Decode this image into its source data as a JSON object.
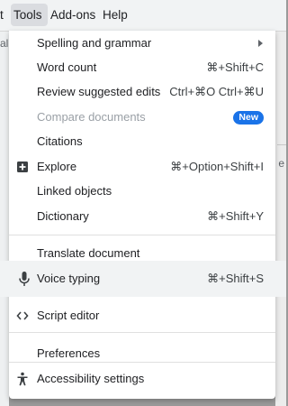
{
  "menubar": {
    "partial_left": "t",
    "items": [
      "Tools",
      "Add-ons",
      "Help"
    ],
    "active": "Tools"
  },
  "background": {
    "left_fragment": "al",
    "right_fragment": "e"
  },
  "tools_menu": {
    "items": [
      {
        "label": "Spelling and grammar",
        "shortcut": "",
        "submenu": true
      },
      {
        "label": "Word count",
        "shortcut": "⌘+Shift+C"
      },
      {
        "label": "Review suggested edits",
        "shortcut": "Ctrl+⌘O Ctrl+⌘U"
      },
      {
        "label": "Compare documents",
        "badge": "New",
        "disabled": true
      },
      {
        "label": "Citations",
        "shortcut": ""
      },
      {
        "label": "Explore",
        "shortcut": "⌘+Option+Shift+I",
        "icon": "explore-icon"
      },
      {
        "label": "Linked objects",
        "shortcut": ""
      },
      {
        "label": "Dictionary",
        "shortcut": "⌘+Shift+Y"
      },
      {
        "label": "Translate document",
        "shortcut": ""
      },
      {
        "label": "Voice typing",
        "shortcut": "⌘+Shift+S",
        "icon": "microphone-icon",
        "highlighted": true
      },
      {
        "label": "Script editor",
        "shortcut": "",
        "icon": "code-icon"
      },
      {
        "label": "Preferences",
        "shortcut": ""
      },
      {
        "label": "Accessibility settings",
        "shortcut": "",
        "icon": "accessibility-icon"
      }
    ]
  },
  "colors": {
    "badge": "#1a73e8",
    "highlight": "#f1f3f4",
    "disabled_text": "#9aa0a6"
  }
}
